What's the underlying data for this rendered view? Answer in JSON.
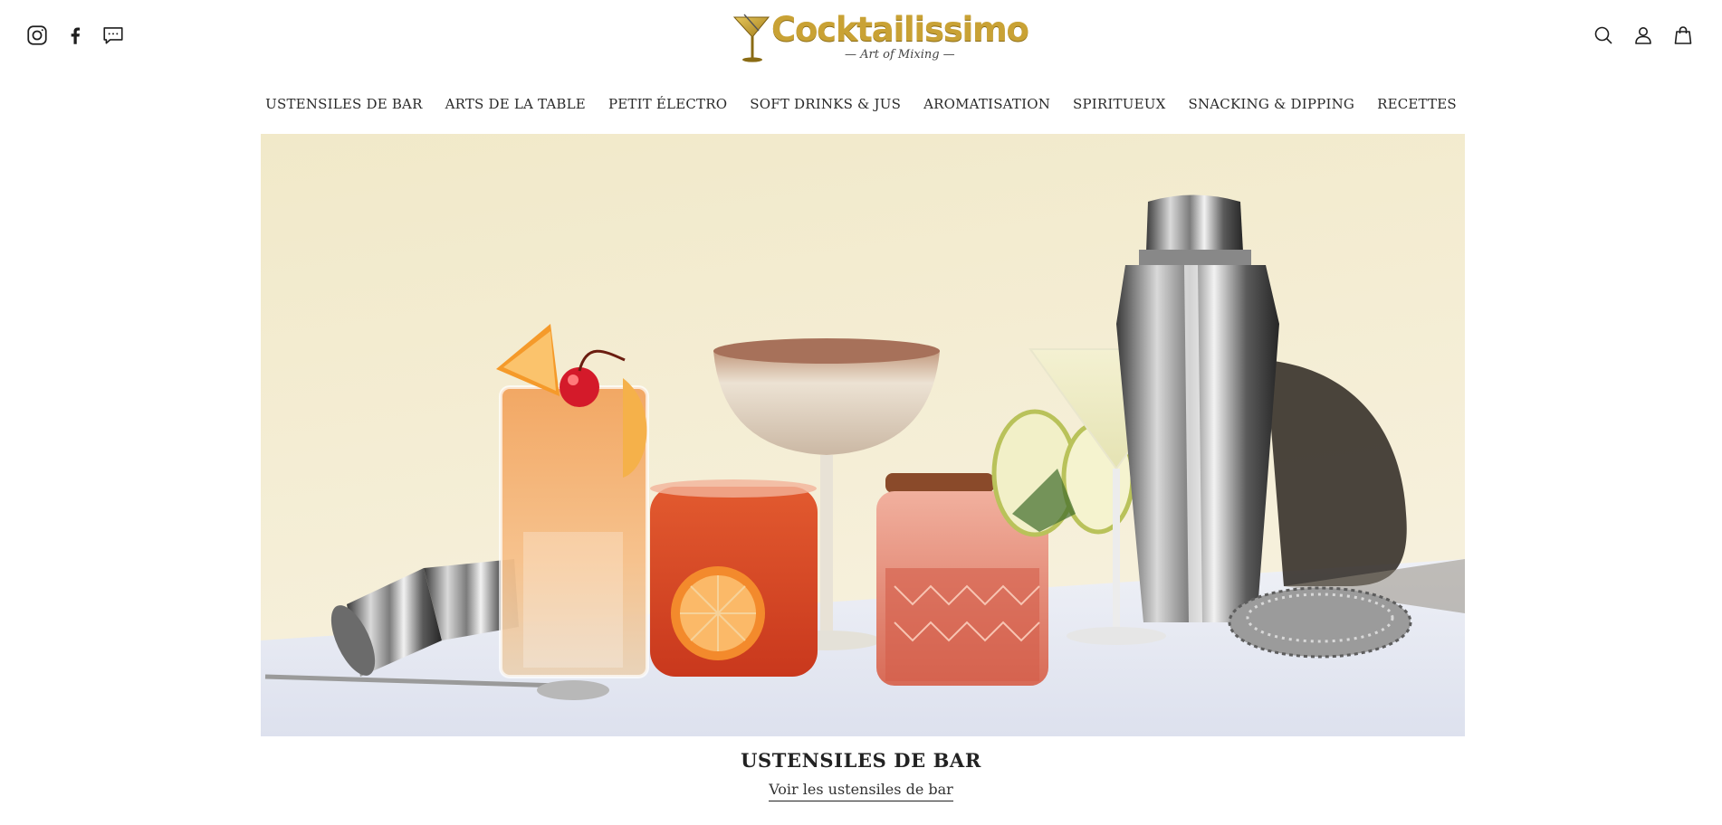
{
  "social": [
    {
      "name": "instagram-icon"
    },
    {
      "name": "facebook-icon"
    },
    {
      "name": "chat-icon"
    }
  ],
  "logo": {
    "brand": "Cocktailissimo",
    "tagline": "— Art of Mixing —",
    "brand_color": "#c9a235"
  },
  "actions": [
    {
      "name": "search-icon"
    },
    {
      "name": "account-icon"
    },
    {
      "name": "cart-icon"
    }
  ],
  "nav": {
    "items": [
      "USTENSILES DE BAR",
      "ARTS DE LA TABLE",
      "PETIT ÉLECTRO",
      "SOFT DRINKS & JUS",
      "AROMATISATION",
      "SPIRITUEUX",
      "SNACKING & DIPPING",
      "RECETTES"
    ]
  },
  "hero": {
    "title": "USTENSILES DE BAR",
    "link": "Voir les ustensiles de bar",
    "bg_color": "#f3eddc"
  }
}
